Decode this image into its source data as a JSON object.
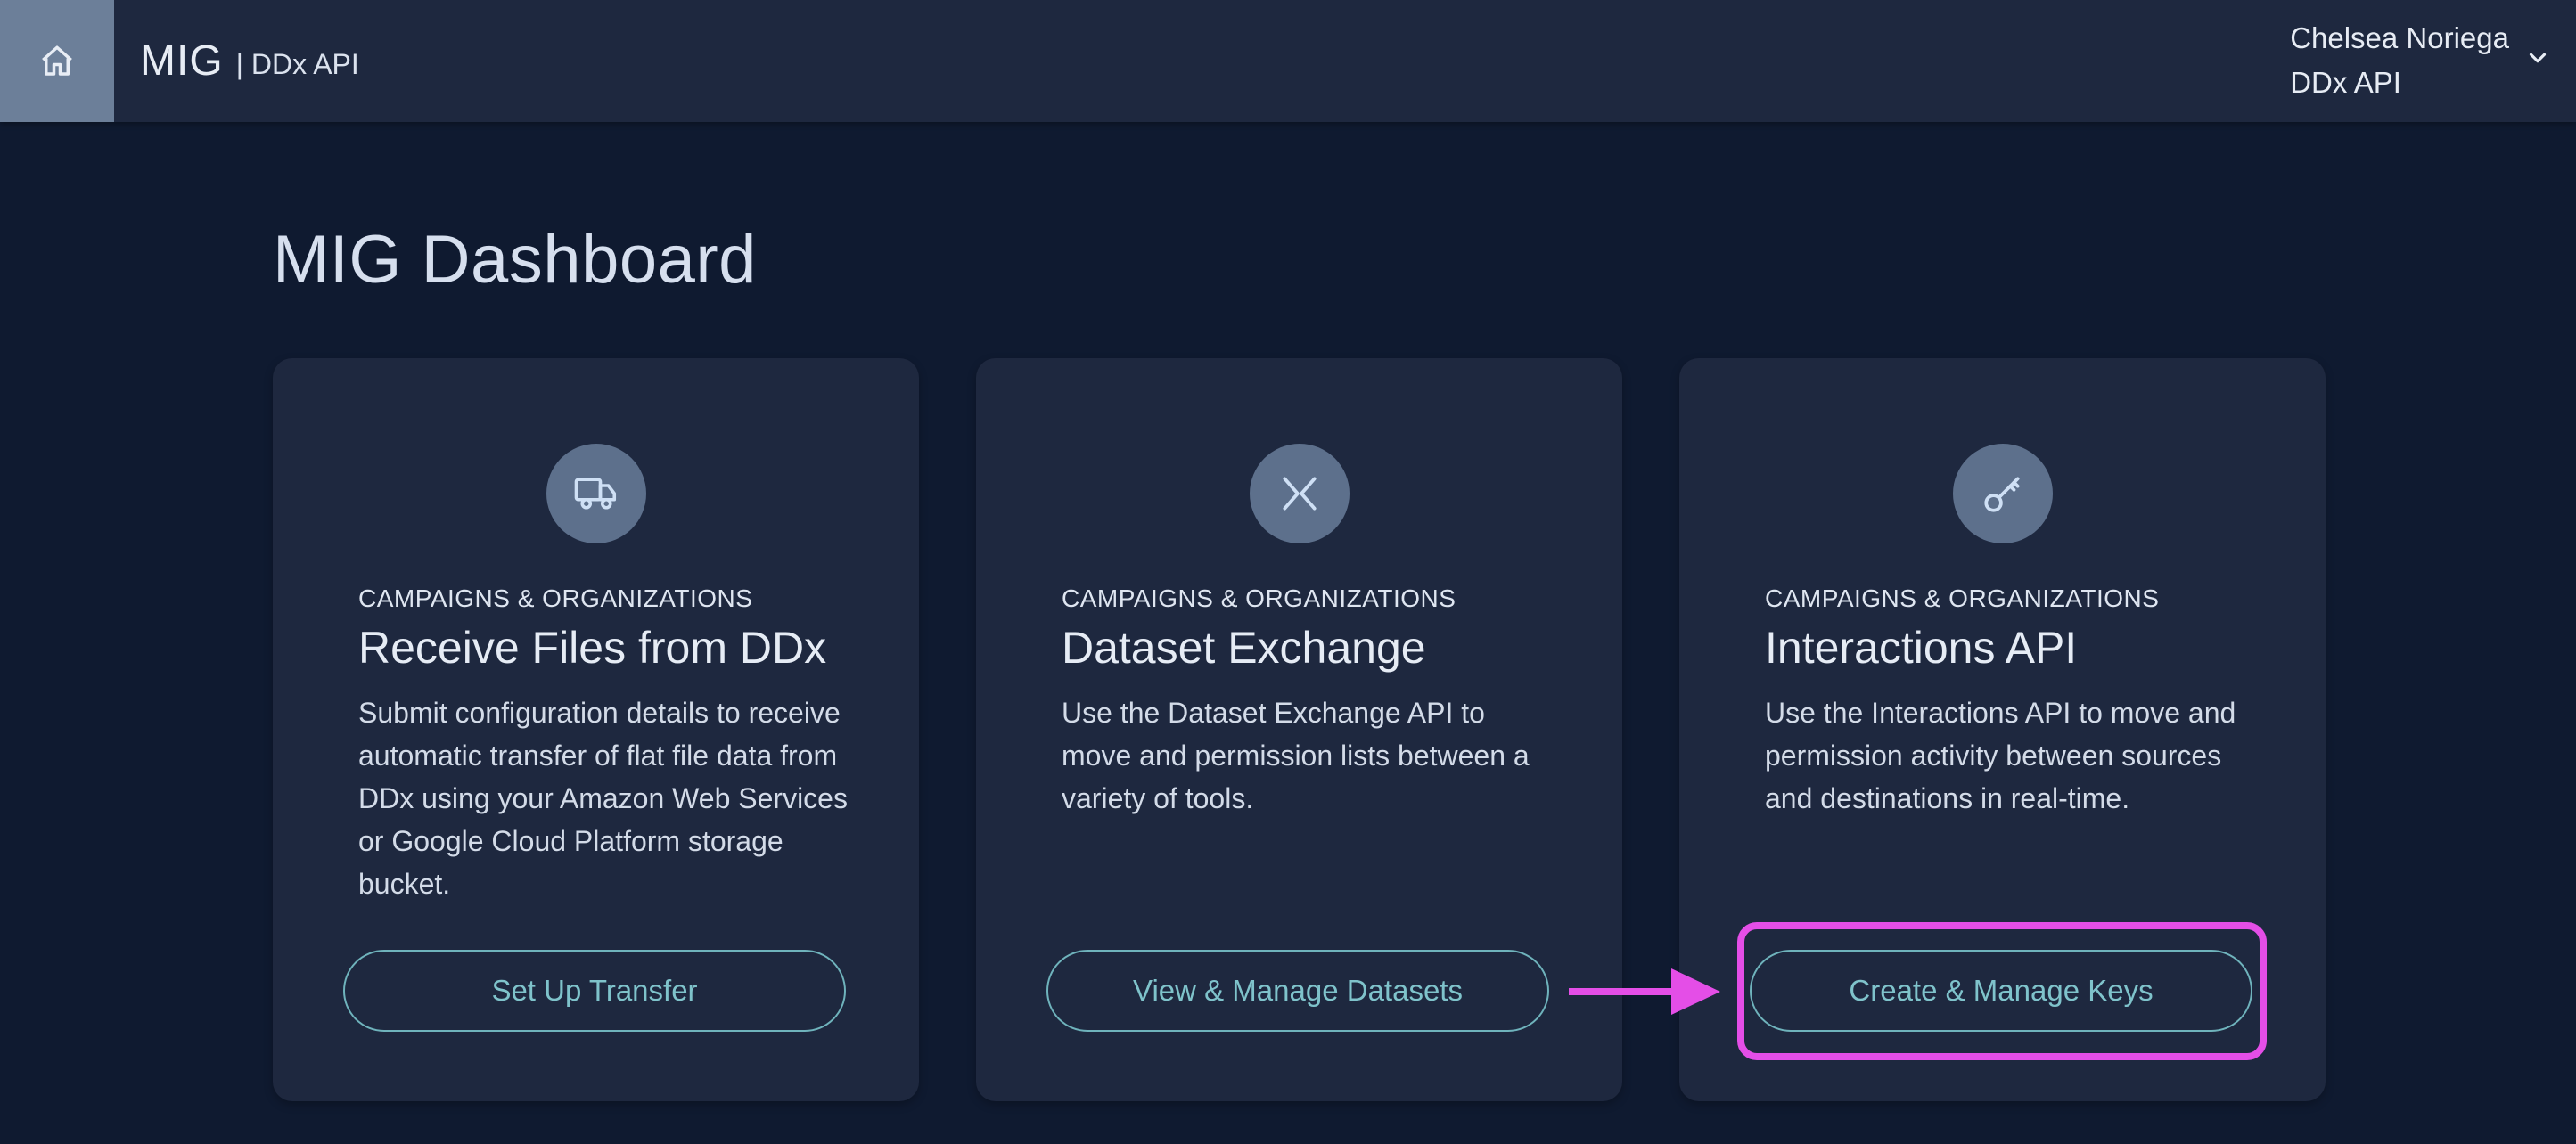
{
  "header": {
    "brand_name": "MIG",
    "brand_sub": "| DDx API",
    "user_name": "Chelsea Noriega",
    "user_org": "DDx API"
  },
  "page": {
    "title": "MIG Dashboard"
  },
  "cards": [
    {
      "icon": "truck-icon",
      "eyebrow": "CAMPAIGNS & ORGANIZATIONS",
      "title": "Receive Files from DDx",
      "description": "Submit configuration details to receive automatic transfer of flat file data from DDx using your Amazon Web Services or Google Cloud Platform storage bucket.",
      "action_label": "Set Up Transfer"
    },
    {
      "icon": "exchange-icon",
      "eyebrow": "CAMPAIGNS & ORGANIZATIONS",
      "title": "Dataset Exchange",
      "description": "Use the Dataset Exchange API to move and permission lists between a variety of tools.",
      "action_label": "View & Manage Datasets"
    },
    {
      "icon": "key-icon",
      "eyebrow": "CAMPAIGNS & ORGANIZATIONS",
      "title": "Interactions API",
      "description": "Use the Interactions API to move and permission activity between sources and destinations in real-time.",
      "action_label": "Create & Manage Keys"
    }
  ],
  "colors": {
    "background": "#0f1a30",
    "surface": "#1e283f",
    "accent": "#7fc3cb",
    "annotation": "#e44ee7"
  }
}
